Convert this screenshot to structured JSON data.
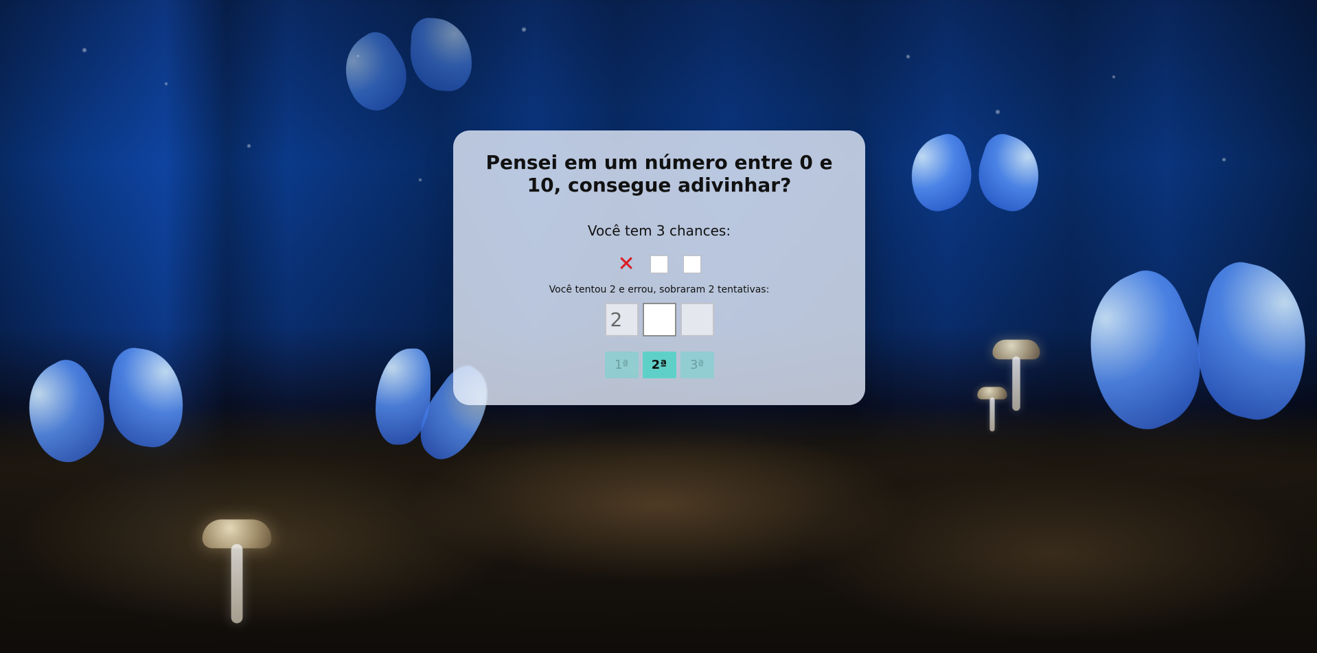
{
  "ui": {
    "title": "Pensei em um número entre 0 e 10, consegue adivinhar?",
    "chances_label": "Você tem 3 chances:",
    "status_text": "Você tentou 2 e errou, sobraram 2 tentativas:",
    "chances": [
      {
        "state": "failed",
        "mark": "✕"
      },
      {
        "state": "available",
        "mark": ""
      },
      {
        "state": "available",
        "mark": ""
      }
    ],
    "guesses": [
      {
        "value": "2",
        "state": "disabled"
      },
      {
        "value": "",
        "state": "active"
      },
      {
        "value": "",
        "state": "disabled"
      }
    ],
    "buttons": [
      {
        "label": "1ª",
        "state": "disabled"
      },
      {
        "label": "2ª",
        "state": "active"
      },
      {
        "label": "3ª",
        "state": "disabled"
      }
    ],
    "colors": {
      "accent": "#5fd0c8",
      "error": "#e01b24"
    }
  }
}
